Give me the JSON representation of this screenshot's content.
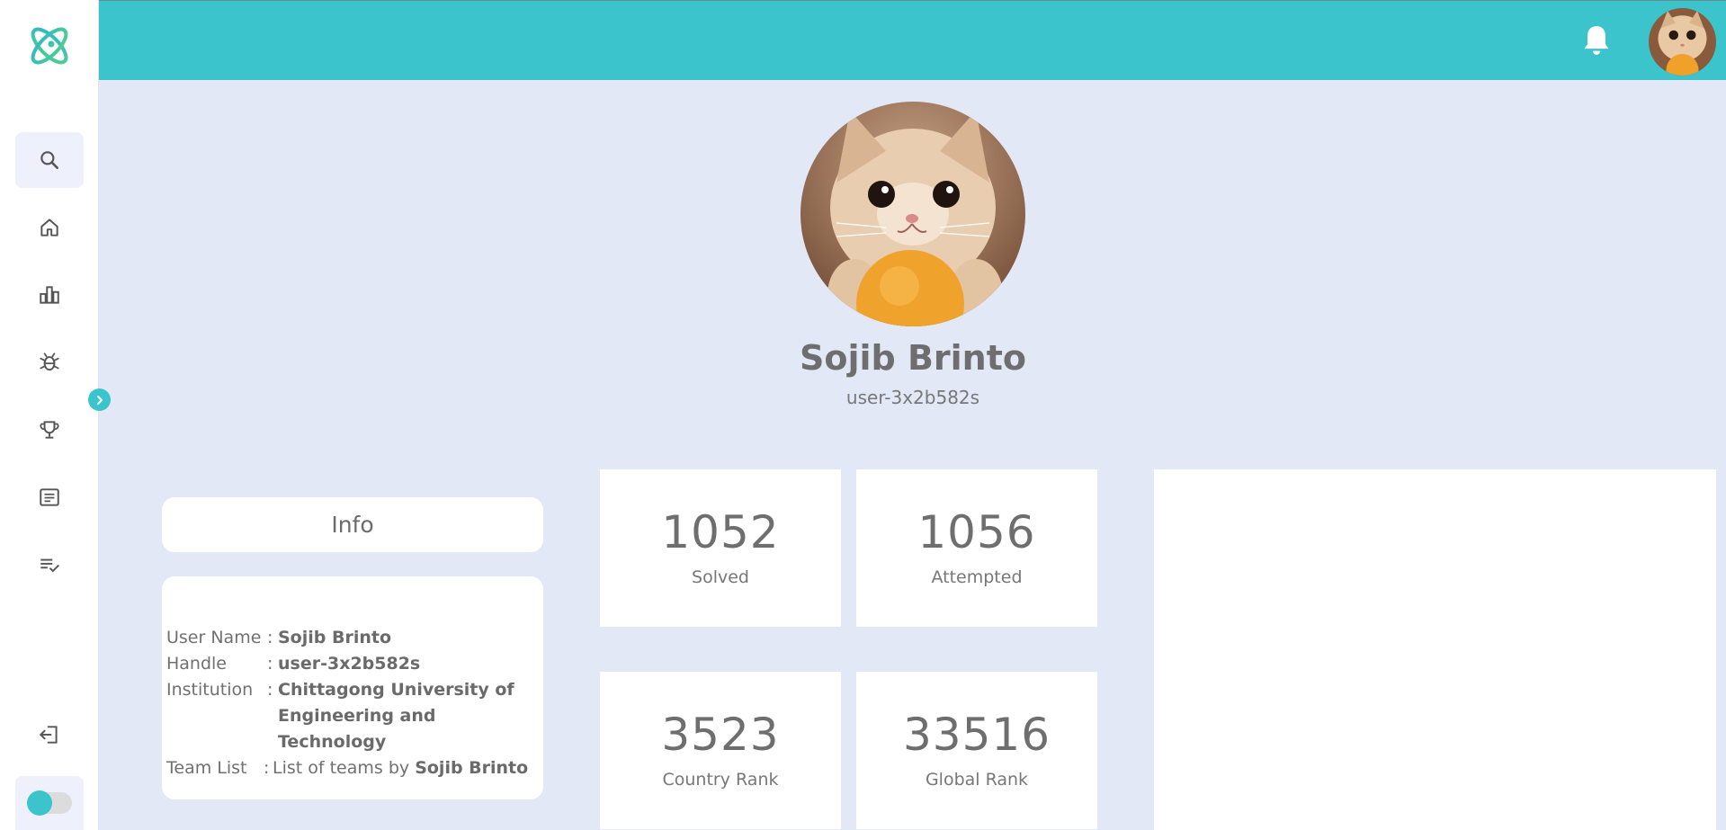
{
  "colors": {
    "accent": "#3bc4cb",
    "background": "#e3e8f7",
    "card": "#ffffff"
  },
  "sidebar": {
    "logo": "atom-logo-icon",
    "items": [
      {
        "icon": "search-icon",
        "active": true
      },
      {
        "icon": "home-icon",
        "active": false
      },
      {
        "icon": "bar-chart-icon",
        "active": false
      },
      {
        "icon": "bug-icon",
        "active": false
      },
      {
        "icon": "trophy-icon",
        "active": false
      },
      {
        "icon": "article-icon",
        "active": false
      },
      {
        "icon": "checklist-icon",
        "active": false
      }
    ],
    "expand_icon": "chevron-right-icon",
    "logout_icon": "logout-icon",
    "theme_toggle": "off"
  },
  "header": {
    "notification_icon": "bell-icon",
    "avatar": "user-avatar-cat"
  },
  "profile": {
    "name": "Sojib Brinto",
    "handle": "user-3x2b582s"
  },
  "info": {
    "title": "Info",
    "rows": {
      "username_label": "User Name",
      "username_sep": ":",
      "username_value": "Sojib Brinto",
      "handle_label": "Handle",
      "handle_sep": ":",
      "handle_value": "user-3x2b582s",
      "institution_label": "Institution",
      "institution_sep": ":",
      "institution_value": "Chittagong University of Engineering and Technology",
      "team_label": "Team List",
      "team_sep": ":",
      "team_prefix": "List of teams by",
      "team_owner": "Sojib Brinto"
    }
  },
  "stats": {
    "solved": {
      "value": "1052",
      "label": "Solved"
    },
    "attempted": {
      "value": "1056",
      "label": "Attempted"
    },
    "country_rank": {
      "value": "3523",
      "label": "Country Rank"
    },
    "global_rank": {
      "value": "33516",
      "label": "Global Rank"
    }
  }
}
